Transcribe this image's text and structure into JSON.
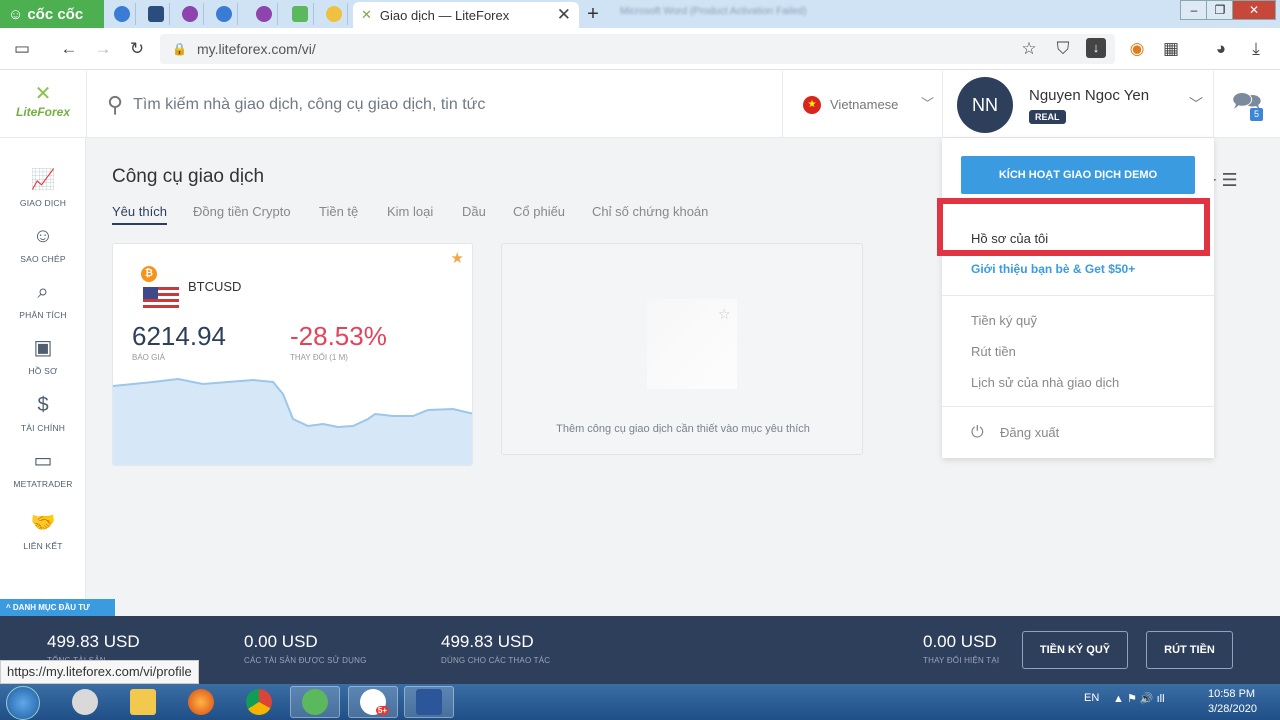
{
  "browser": {
    "brand": "cốc cốc",
    "active_tab_title": "Giao dịch — LiteForex",
    "blurred_tab_title": "Microsoft Word (Product Activation Failed)",
    "url": "my.liteforex.com/vi/",
    "status_url": "https://my.liteforex.com/vi/profile"
  },
  "header": {
    "logo_text": "LiteForex",
    "search_placeholder": "Tìm kiếm nhà giao dịch, công cụ giao dịch, tin tức",
    "language": "Vietnamese",
    "user_initials": "NN",
    "user_name": "Nguyen Ngoc Yen",
    "account_type": "REAL",
    "chat_count": "5"
  },
  "sidebar": {
    "items": [
      {
        "label": "GIAO DỊCH",
        "icon": "chart-icon"
      },
      {
        "label": "SAO CHÉP",
        "icon": "user-icon"
      },
      {
        "label": "PHÂN TÍCH",
        "icon": "analytics-icon"
      },
      {
        "label": "HỒ SƠ",
        "icon": "profile-card-icon"
      },
      {
        "label": "TÀI CHÍNH",
        "icon": "dollar-icon"
      },
      {
        "label": "METATRADER",
        "icon": "window-icon"
      },
      {
        "label": "LIÊN KẾT",
        "icon": "handshake-icon"
      }
    ]
  },
  "main": {
    "title": "Công cụ giao dịch",
    "tabs": [
      "Yêu thích",
      "Đồng tiền Crypto",
      "Tiền tệ",
      "Kim loại",
      "Dầu",
      "Cổ phiếu",
      "Chỉ số chứng khoán"
    ],
    "card": {
      "pair": "BTCUSD",
      "price": "6214.94",
      "price_label": "BÁO GIÁ",
      "change": "-28.53%",
      "change_label": "THAY ĐỔI (1 M)"
    },
    "empty_text": "Thêm công cụ giao dịch cần thiết vào mục yêu thích"
  },
  "dropdown": {
    "demo_button": "KÍCH HOẠT GIAO DỊCH DEMO",
    "profile": "Hồ sơ của tôi",
    "refer": "Giới thiệu bạn bè & Get $50+",
    "deposit": "Tiền ký quỹ",
    "withdraw": "Rút tiền",
    "history": "Lịch sử của nhà giao dịch",
    "logout": "Đăng xuất"
  },
  "bottom": {
    "portfolio_tab": "DANH MỤC ĐẦU TƯ",
    "stats": [
      {
        "value": "499.83 USD",
        "label": "TỔNG TÀI SẢN"
      },
      {
        "value": "0.00 USD",
        "label": "CÁC TÀI SẢN ĐƯỢC SỬ DỤNG"
      },
      {
        "value": "499.83 USD",
        "label": "DÙNG CHO CÁC THAO TÁC"
      },
      {
        "value": "0.00 USD",
        "label": "THAY ĐỔI HIỆN TẠI"
      }
    ],
    "deposit_button": "TIỀN KÝ QUỸ",
    "withdraw_button": "RÚT TIỀN"
  },
  "taskbar": {
    "lang": "EN",
    "time": "10:58 PM",
    "date": "3/28/2020",
    "zalo_badge": "5+"
  },
  "colors": {
    "accent": "#3a9be0",
    "navy": "#2e3f5c",
    "negative": "#e5435a",
    "highlight": "#e13341"
  }
}
